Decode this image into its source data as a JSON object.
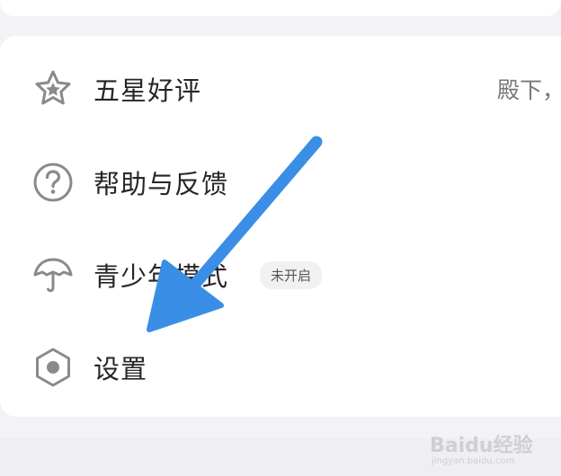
{
  "menu": {
    "items": [
      {
        "label": "五星好评",
        "value": "殿下，",
        "icon": "star-icon"
      },
      {
        "label": "帮助与反馈",
        "icon": "question-circle-icon"
      },
      {
        "label": "青少年模式",
        "badge": "未开启",
        "icon": "umbrella-icon"
      },
      {
        "label": "设置",
        "icon": "hexagon-settings-icon"
      }
    ]
  },
  "annotation": {
    "arrow_color": "#3a8ee6",
    "arrow_icon": "arrow-down-left-icon"
  },
  "watermark": {
    "main": "Baidu经验",
    "sub": "jingyan.baidu.com"
  },
  "colors": {
    "icon_gray": "#8a8a8a",
    "background": "#f3f3f5",
    "card": "#ffffff"
  }
}
